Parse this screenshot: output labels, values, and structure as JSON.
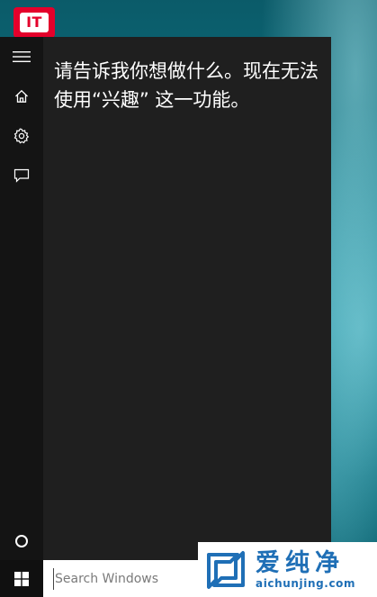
{
  "desktop": {
    "logo_text": "IT"
  },
  "cortana": {
    "message": "请告诉我你想做什么。现在无法使用“兴趣” 这一功能。",
    "rail": {
      "icons": [
        "hamburger-menu-icon",
        "home-icon",
        "gear-icon",
        "chat-bubble-icon",
        "cortana-circle-icon"
      ]
    }
  },
  "taskbar": {
    "start_icon": "windows-logo-icon",
    "search": {
      "placeholder": "Search Windows",
      "value": ""
    }
  },
  "watermark": {
    "title": "爱纯净",
    "url": "aichunjing.com"
  },
  "colors": {
    "panel_background": "#1f1f1f",
    "rail_background": "#141414",
    "taskbar_background": "#101010",
    "logo_red": "#e4002b",
    "watermark_blue": "#1f6fb6",
    "wallpaper_teal": "#0b7f8f"
  }
}
